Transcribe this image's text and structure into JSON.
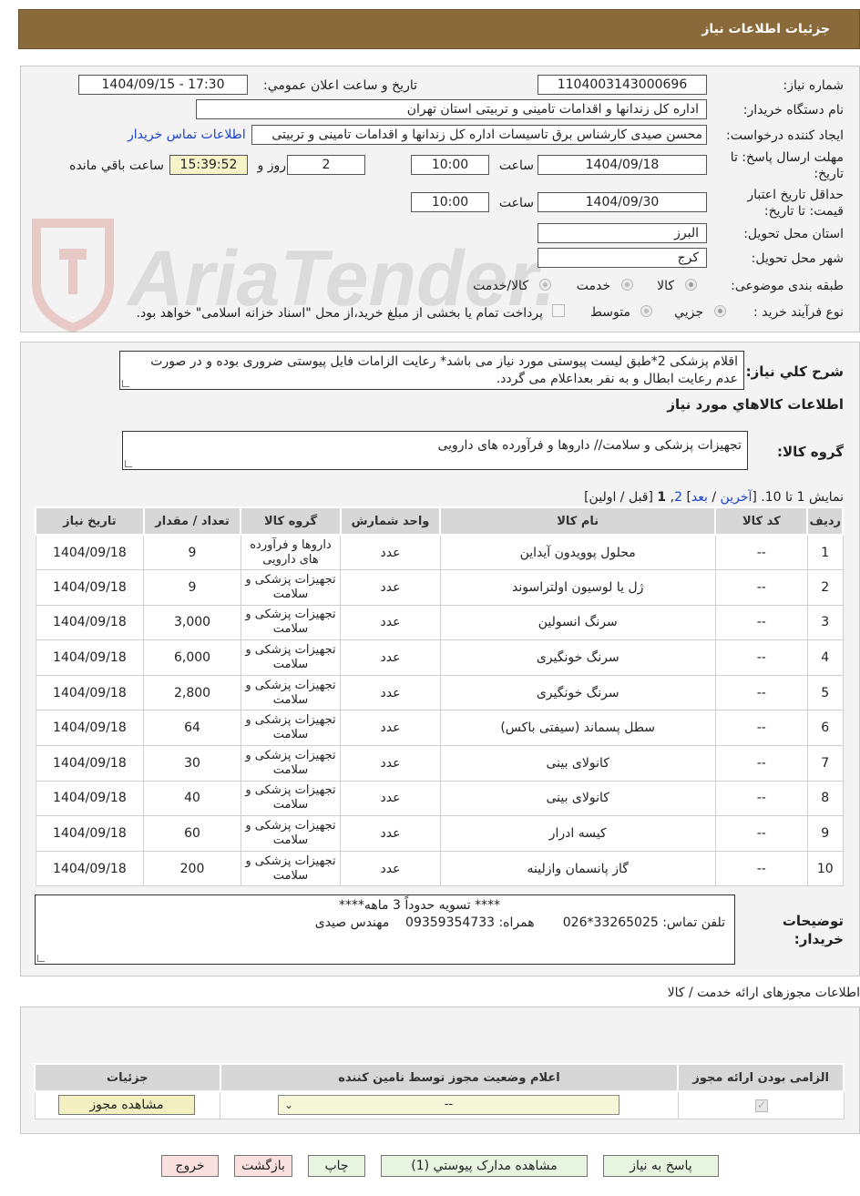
{
  "header": {
    "title": "جزئیات اطلاعات نیاز"
  },
  "watermark": {
    "text": "AriaTender.neT"
  },
  "form": {
    "need_number": {
      "label": "شماره نیاز:",
      "value": "1104003143000696"
    },
    "announce": {
      "label": "تاریخ و ساعت اعلان عمومي:",
      "value": "1404/09/15 - 17:30"
    },
    "buyer": {
      "label": "نام دستگاه خریدار:",
      "value": "اداره کل زندانها و اقدامات تامینی و تربیتی استان تهران"
    },
    "creator": {
      "label": "ایجاد کننده درخواست:",
      "value": "محسن صیدی کارشناس برق تاسیسات  اداره کل زندانها و اقدامات تامینی و تربیتی",
      "contact_link": "اطلاعات تماس خریدار"
    },
    "deadline": {
      "label_line1": "مهلت ارسال پاسخ: تا",
      "label_line2": "تاریخ:",
      "date": "1404/09/18",
      "time_label": "ساعت",
      "time": "10:00",
      "days": "2",
      "days_label": "روز و",
      "remaining": "15:39:52",
      "remaining_label": "ساعت باقي مانده"
    },
    "validity": {
      "label_line1": "حداقل تاریخ اعتبار",
      "label_line2": "قیمت: تا تاریخ:",
      "date": "1404/09/30",
      "time_label": "ساعت",
      "time": "10:00"
    },
    "province": {
      "label": "استان محل تحویل:",
      "value": "البرز"
    },
    "city": {
      "label": "شهر محل تحویل:",
      "value": "کرج"
    },
    "category": {
      "label": "طبقه بندی موضوعی:",
      "options": [
        "کالا",
        "خدمت",
        "کالا/خدمت"
      ]
    },
    "process": {
      "label": "نوع فرآیند خرید :",
      "options": [
        "جزیي",
        "متوسط"
      ],
      "note": "پرداخت تمام یا بخشی از مبلغ خرید،از محل \"اسناد خزانه اسلامی\" خواهد بود."
    }
  },
  "description": {
    "label": "شرح کلي نياز:",
    "line1": "اقلام پزشکی 2*طبق لیست پیوستی مورد نیاز می باشد* رعایت الزامات فایل پیوستی ضروری بوده و در صورت",
    "line2": "عدم رعایت ابطال و به نفر بعداعلام می گردد."
  },
  "goods": {
    "section_title": "اطلاعات کالاهاي مورد نياز",
    "group_label": "گروه کالا:",
    "group_value": "تجهیزات پزشکی و سلامت// داروها و فرآورده های دارویی",
    "pager": {
      "showing": "نمایش 1 تا 10.",
      "open": "[",
      "last": "آخرین",
      "sep1": "/",
      "next": "بعد",
      "close_mid": "]",
      "page2": "2",
      "comma": ",",
      "page1": "1",
      "prev_first": "[قبل / اولین]"
    },
    "columns": [
      "ردیف",
      "کد کالا",
      "نام کالا",
      "واحد شمارش",
      "گروه کالا",
      "تعداد / مقدار",
      "تاریخ نیاز"
    ],
    "rows": [
      [
        "1",
        "--",
        "محلول پوویدون آیداین",
        "عدد",
        "داروها و فرآورده های دارویی",
        "9",
        "1404/09/18"
      ],
      [
        "2",
        "--",
        "ژل یا لوسیون اولتراسوند",
        "عدد",
        "تجهیزات پزشکی و سلامت",
        "9",
        "1404/09/18"
      ],
      [
        "3",
        "--",
        "سرنگ انسولین",
        "عدد",
        "تجهیزات پزشکی و سلامت",
        "3,000",
        "1404/09/18"
      ],
      [
        "4",
        "--",
        "سرنگ خونگیری",
        "عدد",
        "تجهیزات پزشکی و سلامت",
        "6,000",
        "1404/09/18"
      ],
      [
        "5",
        "--",
        "سرنگ خونگیری",
        "عدد",
        "تجهیزات پزشکی و سلامت",
        "2,800",
        "1404/09/18"
      ],
      [
        "6",
        "--",
        "سطل پسماند (سیفتی باکس)",
        "عدد",
        "تجهیزات پزشکی و سلامت",
        "64",
        "1404/09/18"
      ],
      [
        "7",
        "--",
        "کانولای بینی",
        "عدد",
        "تجهیزات پزشکی و سلامت",
        "30",
        "1404/09/18"
      ],
      [
        "8",
        "--",
        "کانولای بینی",
        "عدد",
        "تجهیزات پزشکی و سلامت",
        "40",
        "1404/09/18"
      ],
      [
        "9",
        "--",
        "کیسه ادرار",
        "عدد",
        "تجهیزات پزشکی و سلامت",
        "60",
        "1404/09/18"
      ],
      [
        "10",
        "--",
        "گاز پانسمان وازلینه",
        "عدد",
        "تجهیزات پزشکی و سلامت",
        "200",
        "1404/09/18"
      ]
    ]
  },
  "buyer_notes": {
    "label_line1": "توضیحات",
    "label_line2": "خریدار:",
    "line1": "**** تسویه حدوداً 3 ماهه****",
    "line2": "تلفن تماس: 33265025*026       همراه: 09359354733    مهندس صیدی"
  },
  "permits": {
    "title": "اطلاعات مجوزهای ارائه خدمت / کالا",
    "columns": [
      "الزامی بودن ارائه مجوز",
      "اعلام وضعیت مجوز توسط نامین کننده",
      "جزئیات"
    ],
    "select_value": "--",
    "view_button": "مشاهده مجوز"
  },
  "actions": {
    "reply": "پاسخ به نیاز",
    "view_docs": "مشاهده مدارک پیوستي (1)",
    "print": "چاپ",
    "back": "بازگشت",
    "exit": "خروج"
  }
}
